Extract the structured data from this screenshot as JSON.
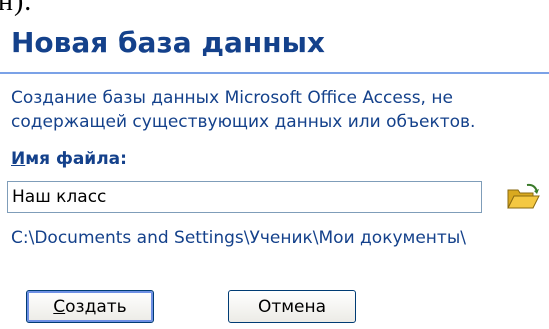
{
  "top_fragment": "н).",
  "panel": {
    "title": "Новая база данных",
    "description": "Создание базы данных Microsoft Office Access, не содержащей существующих данных или объектов.",
    "file_label": {
      "hotkey": "И",
      "rest": "мя файла:"
    },
    "file_name_value": "Наш класс",
    "save_path": "C:\\Documents and Settings\\Ученик\\Мои документы\\",
    "browse_icon": "folder-open-icon"
  },
  "buttons": {
    "create": {
      "hotkey": "С",
      "rest": "оздать"
    },
    "cancel_label": "Отмена"
  },
  "colors": {
    "accent_text": "#14418b",
    "divider": "#7ba2e7",
    "button_border": "#003c74",
    "folder": "#f4c842"
  }
}
